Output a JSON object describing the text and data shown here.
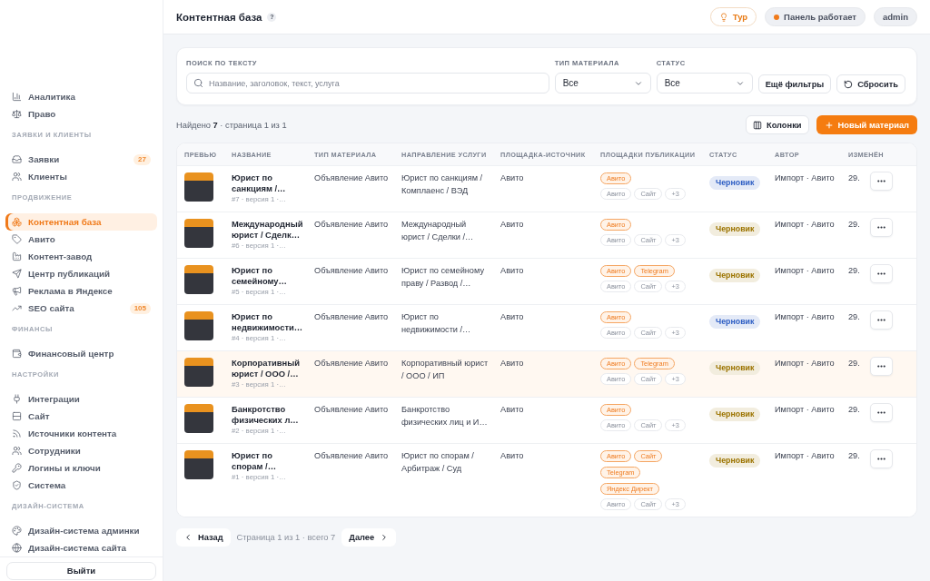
{
  "sidebar": {
    "sections": [
      {
        "items": [
          {
            "label": "Аналитика",
            "selected": false
          },
          {
            "label": "Право",
            "selected": false
          }
        ]
      },
      {
        "title": "ЗАЯВКИ И КЛИЕНТЫ",
        "items": [
          {
            "label": "Заявки",
            "selected": false,
            "badge": "27"
          },
          {
            "label": "Клиенты",
            "selected": false
          }
        ]
      },
      {
        "title": "ПРОДВИЖЕНИЕ",
        "items": [
          {
            "label": "Контентная база",
            "selected": true
          },
          {
            "label": "Авито",
            "selected": false
          },
          {
            "label": "Контент-завод",
            "selected": false
          },
          {
            "label": "Центр публикаций",
            "selected": false
          },
          {
            "label": "Реклама в Яндексе",
            "selected": false
          },
          {
            "label": "SEO сайта",
            "selected": false,
            "badge": "105"
          }
        ]
      },
      {
        "title": "ФИНАНСЫ",
        "items": [
          {
            "label": "Финансовый центр",
            "selected": false
          }
        ]
      },
      {
        "title": "НАСТРОЙКИ",
        "items": [
          {
            "label": "Интеграции",
            "selected": false
          },
          {
            "label": "Сайт",
            "selected": false
          },
          {
            "label": "Источники контента",
            "selected": false
          },
          {
            "label": "Сотрудники",
            "selected": false
          },
          {
            "label": "Логины и ключи",
            "selected": false
          },
          {
            "label": "Система",
            "selected": false
          }
        ]
      },
      {
        "title": "ДИЗАЙН-СИСТЕМА",
        "items": [
          {
            "label": "Дизайн-система админки",
            "selected": false
          },
          {
            "label": "Дизайн-система сайта",
            "selected": false
          }
        ]
      }
    ],
    "logout": "Выйти"
  },
  "header": {
    "title": "Контентная база",
    "help": "?",
    "tour": "Тур",
    "status": "Панель работает",
    "user": "admin"
  },
  "filters": {
    "search": {
      "label": "ПОИСК ПО ТЕКСТУ",
      "placeholder": "Название, заголовок, текст, услуга"
    },
    "selects": [
      {
        "label": "ТИП МАТЕРИАЛА",
        "value": "Все"
      },
      {
        "label": "СТАТУС",
        "value": "Все"
      }
    ],
    "more": "Ещё фильтры",
    "reset": "Сбросить"
  },
  "summary": {
    "text": "Найдено **7** · страница 1 из 1",
    "columns_button": "Колонки",
    "new_button": "Новый материал"
  },
  "table": {
    "columns": [
      "ПРЕВЬЮ",
      "НАЗВАНИЕ",
      "ТИП МАТЕРИАЛА",
      "НАПРАВЛЕНИЕ УСЛУГИ",
      "ПЛОЩАДКА-ИСТОЧНИК",
      "ПЛОЩАДКИ ПУБЛИКАЦИИ",
      "СТАТУС",
      "АВТОР",
      "ИЗМЕНЁН"
    ],
    "rows": [
      {
        "selected": false,
        "name": "Юрист по\nсанкциям /…",
        "meta": "#7 · версия 1 ·…",
        "type": "Объявление Авито",
        "direction": "Юрист по санкциям /\nКомплаенс / ВЭД",
        "source": "Авито",
        "published": [
          "Авито"
        ],
        "available": [
          "Авито",
          "Сайт",
          "+3"
        ],
        "status": {
          "label": "Черновик",
          "color": "#2f5fc4"
        },
        "author": "Импорт · Авито",
        "modified": "29."
      },
      {
        "selected": false,
        "name": "Международный\nюрист / Сделк…",
        "meta": "#6 · версия 1 ·…",
        "type": "Объявление Авито",
        "direction": "Международный\nюрист / Сделки /…",
        "source": "Авито",
        "published": [
          "Авито"
        ],
        "available": [
          "Авито",
          "Сайт",
          "+3"
        ],
        "status": {
          "label": "Черновик",
          "color": "#9c7400"
        },
        "author": "Импорт · Авито",
        "modified": "29."
      },
      {
        "selected": false,
        "name": "Юрист по\nсемейному…",
        "meta": "#5 · версия 1 ·…",
        "type": "Объявление Авито",
        "direction": "Юрист по семейному\nправу / Развод /…",
        "source": "Авито",
        "published": [
          "Авито",
          "Telegram"
        ],
        "available": [
          "Авито",
          "Сайт",
          "+3"
        ],
        "status": {
          "label": "Черновик",
          "color": "#9c7400"
        },
        "author": "Импорт · Авито",
        "modified": "29."
      },
      {
        "selected": false,
        "name": "Юрист по\nнедвижимости…",
        "meta": "#4 · версия 1 ·…",
        "type": "Объявление Авито",
        "direction": "Юрист по\nнедвижимости /…",
        "source": "Авито",
        "published": [
          "Авито"
        ],
        "available": [
          "Авито",
          "Сайт",
          "+3"
        ],
        "status": {
          "label": "Черновик",
          "color": "#2f5fc4"
        },
        "author": "Импорт · Авито",
        "modified": "29."
      },
      {
        "selected": true,
        "name": "Корпоративный\nюрист / ООО /…",
        "meta": "#3 · версия 1 ·…",
        "type": "Объявление Авито",
        "direction": "Корпоративный юрист\n/ ООО / ИП",
        "source": "Авито",
        "published": [
          "Авито",
          "Telegram"
        ],
        "available": [
          "Авито",
          "Сайт",
          "+3"
        ],
        "status": {
          "label": "Черновик",
          "color": "#9c7400"
        },
        "author": "Импорт · Авито",
        "modified": "29."
      },
      {
        "selected": false,
        "name": "Банкротство\nфизических л…",
        "meta": "#2 · версия 1 ·…",
        "type": "Объявление Авито",
        "direction": "Банкротство\nфизических лиц и И…",
        "source": "Авито",
        "published": [
          "Авито"
        ],
        "available": [
          "Авито",
          "Сайт",
          "+3"
        ],
        "status": {
          "label": "Черновик",
          "color": "#9c7400"
        },
        "author": "Импорт · Авито",
        "modified": "29."
      },
      {
        "selected": false,
        "name": "Юрист по\nспорам /…",
        "meta": "#1 · версия 1 ·…",
        "type": "Объявление Авито",
        "direction": "Юрист по спорам /\nАрбитраж / Суд",
        "source": "Авито",
        "published": [
          "Авито",
          "Сайт",
          "Telegram",
          "Яндекс Директ"
        ],
        "available": [
          "Авито",
          "Сайт",
          "+3"
        ],
        "status": {
          "label": "Черновик",
          "color": "#9c7400"
        },
        "author": "Импорт · Авито",
        "modified": "29."
      }
    ]
  },
  "pagination": {
    "prev": "Назад",
    "info": "Страница 1 из 1 · всего 7",
    "next": "Далее"
  }
}
